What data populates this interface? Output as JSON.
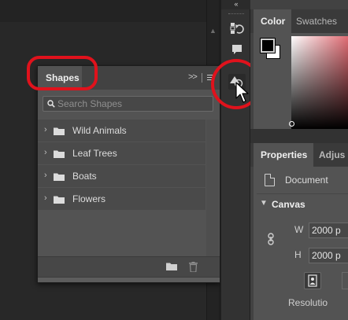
{
  "shapes_panel": {
    "tab_label": "Shapes",
    "collapse_glyph": ">>",
    "search_placeholder": "Search Shapes",
    "search_value": "",
    "groups": [
      {
        "label": "Wild Animals"
      },
      {
        "label": "Leaf Trees"
      },
      {
        "label": "Boats"
      },
      {
        "label": "Flowers"
      }
    ]
  },
  "icon_strip": {
    "collapse_glyph": "«",
    "buttons": [
      {
        "icon": "history-icon"
      },
      {
        "icon": "comments-icon"
      },
      {
        "icon": "shapes-icon",
        "active": true
      }
    ]
  },
  "color_panel": {
    "tabs": [
      "Color",
      "Swatches"
    ],
    "foreground": "#000000",
    "background": "#ffffff"
  },
  "properties_panel": {
    "tabs": [
      "Properties",
      "Adjus"
    ],
    "document_label": "Document",
    "section_label": "Canvas",
    "width_label": "W",
    "height_label": "H",
    "width_value": "2000 p",
    "height_value": "2000 p",
    "resolution_label": "Resolutio"
  },
  "annotation_color": "#e0121c"
}
